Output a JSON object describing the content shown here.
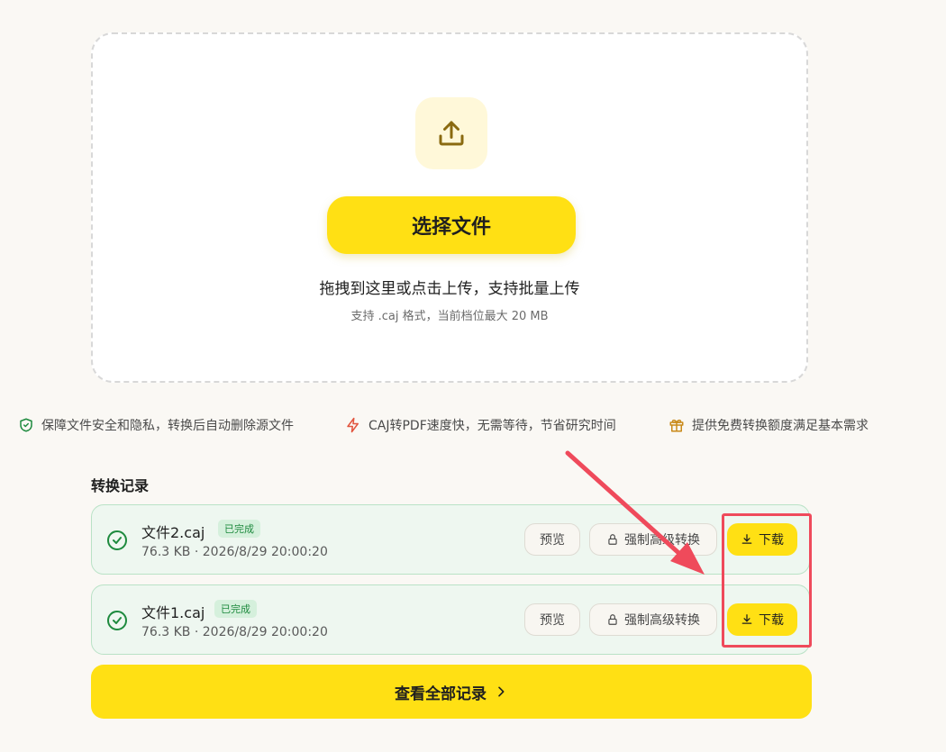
{
  "upload": {
    "icon": "upload-icon",
    "choose_button": "选择文件",
    "hint": "拖拽到这里或点击上传，支持批量上传",
    "sub_hint": "支持 .caj 格式，当前档位最大 20 MB"
  },
  "features": [
    {
      "icon": "shield-check-icon",
      "text": "保障文件安全和隐私，转换后自动删除源文件"
    },
    {
      "icon": "lightning-icon",
      "text": "CAJ转PDF速度快，无需等待，节省研究时间"
    },
    {
      "icon": "gift-icon",
      "text": "提供免费转换额度满足基本需求"
    }
  ],
  "records": {
    "title": "转换记录",
    "items": [
      {
        "filename": "文件2.caj",
        "status": "已完成",
        "meta": "76.3 KB · 2026/8/29 20:00:20",
        "preview_label": "预览",
        "force_label": "强制高级转换",
        "download_label": "下载"
      },
      {
        "filename": "文件1.caj",
        "status": "已完成",
        "meta": "76.3 KB · 2026/8/29 20:00:20",
        "preview_label": "预览",
        "force_label": "强制高级转换",
        "download_label": "下载"
      }
    ],
    "view_all": "查看全部记录"
  },
  "colors": {
    "accent": "#ffe014",
    "success": "#1e8a3e",
    "annotation": "#ef4a5b",
    "icon_brown": "#8a6a10"
  }
}
